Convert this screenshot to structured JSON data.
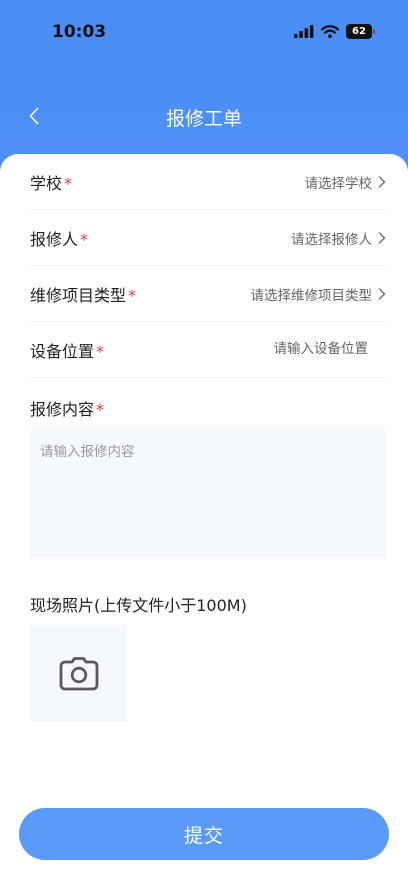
{
  "status_bar": {
    "time": "10:03",
    "battery": "62"
  },
  "nav": {
    "title": "报修工单"
  },
  "form": {
    "rows": [
      {
        "label": "学校",
        "required": "*",
        "value": "请选择学校"
      },
      {
        "label": "报修人",
        "required": "*",
        "value": "请选择报修人"
      },
      {
        "label": "维修项目类型",
        "required": "*",
        "value": "请选择维修项目类型"
      },
      {
        "label": "设备位置",
        "required": "*",
        "value": "请输入设备位置"
      }
    ],
    "content": {
      "label": "报修内容",
      "required": "*",
      "placeholder": "请输入报修内容"
    },
    "photo": {
      "label": "现场照片(上传文件小于100M)"
    }
  },
  "submit": {
    "label": "提交"
  },
  "colors": {
    "accent": "#4a8df7",
    "button": "#5b9bf8",
    "required": "#e03a3a"
  }
}
